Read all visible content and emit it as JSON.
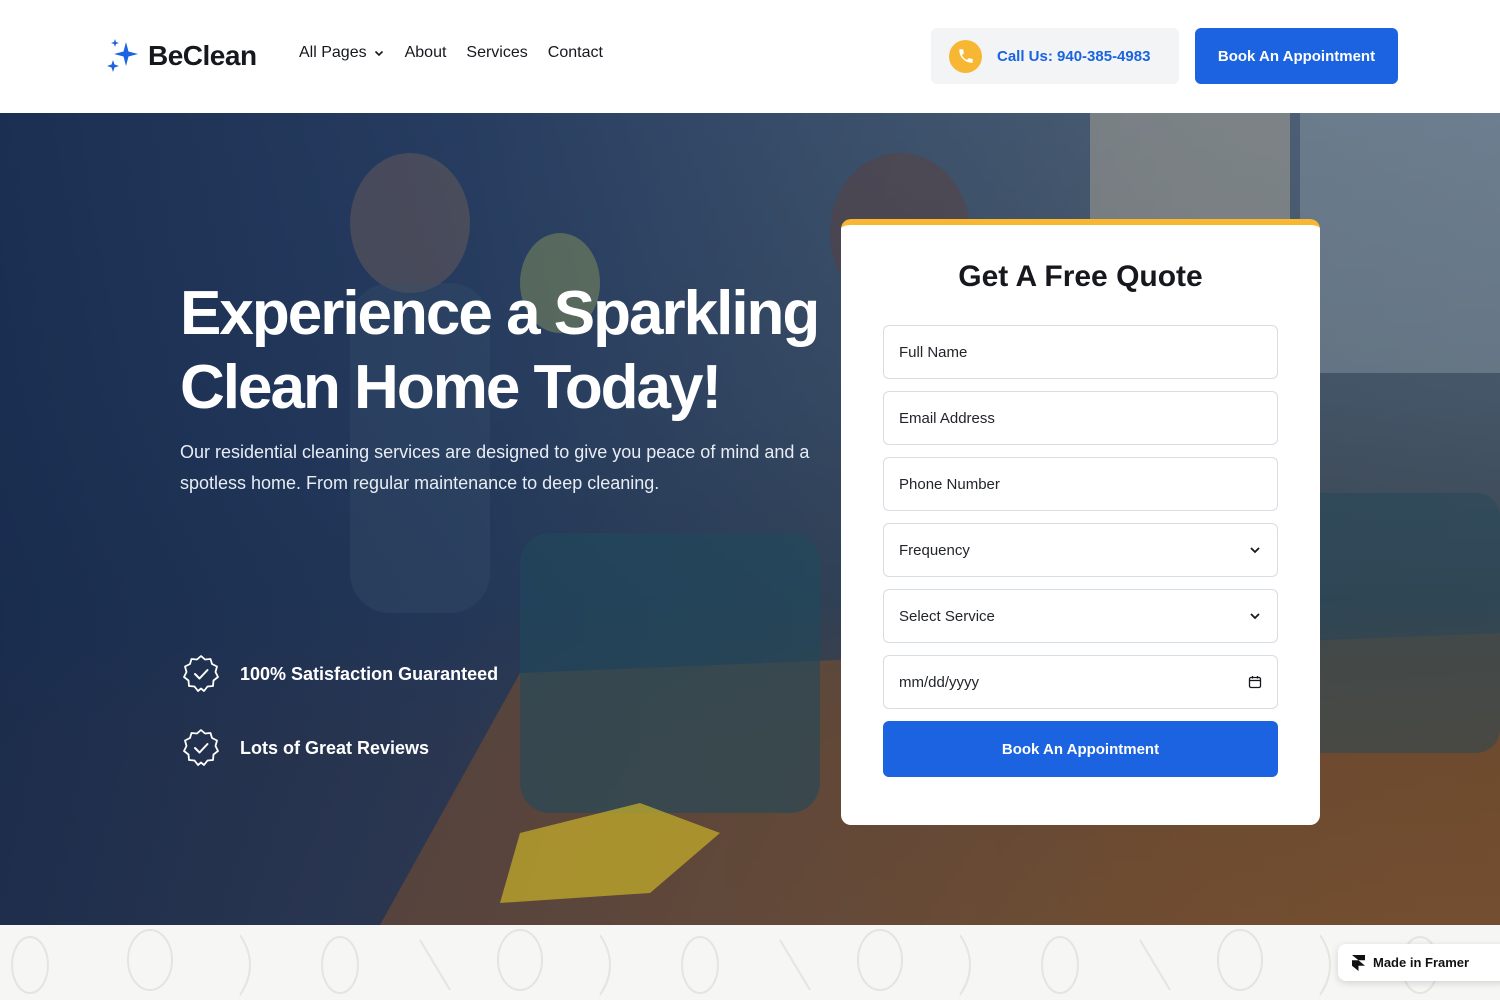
{
  "header": {
    "logo_text": "BeClean",
    "nav": [
      {
        "label": "All Pages",
        "has_dropdown": true
      },
      {
        "label": "About"
      },
      {
        "label": "Services"
      },
      {
        "label": "Contact"
      }
    ],
    "call_label": "Call Us: 940-385-4983",
    "cta_label": "Book An Appointment"
  },
  "hero": {
    "title": "Experience a Sparkling Clean Home Today!",
    "subtitle": "Our residential cleaning services are designed to give you peace of mind and a spotless home. From regular maintenance to deep cleaning.",
    "features": [
      {
        "label": "100% Satisfaction Guaranteed",
        "icon": "check-badge-icon"
      },
      {
        "label": "Lots of Great Reviews",
        "icon": "check-badge-icon"
      }
    ]
  },
  "quote_form": {
    "title": "Get A Free Quote",
    "fields": {
      "full_name": "Full Name",
      "email": "Email Address",
      "phone": "Phone Number",
      "frequency": "Frequency",
      "service": "Select Service",
      "date": "mm/dd/yyyy"
    },
    "submit_label": "Book An Appointment"
  },
  "badge": {
    "label": "Made in Framer"
  },
  "colors": {
    "primary": "#1b63e0",
    "accent": "#f7b733",
    "hero_overlay": "#1c3258"
  }
}
